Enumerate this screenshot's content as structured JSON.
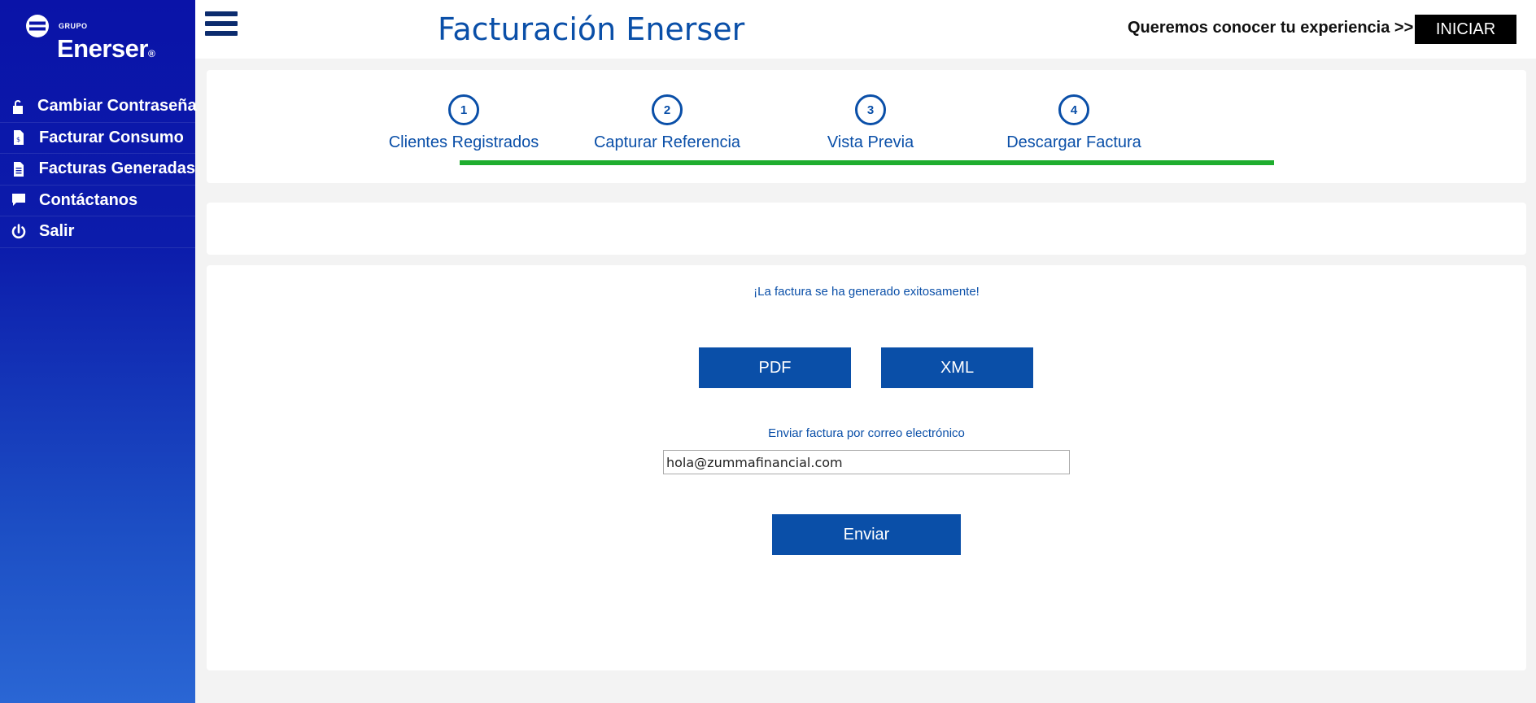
{
  "brand": {
    "group_label": "GRUPO",
    "name": "Enerser",
    "mark": "®"
  },
  "sidebar": {
    "items": [
      {
        "label": "Cambiar Contraseña",
        "icon": "unlock-icon"
      },
      {
        "label": "Facturar Consumo",
        "icon": "invoice-dollar-icon"
      },
      {
        "label": "Facturas Generadas",
        "icon": "document-icon"
      },
      {
        "label": "Contáctanos",
        "icon": "chat-icon"
      },
      {
        "label": "Salir",
        "icon": "power-icon"
      }
    ]
  },
  "header": {
    "title": "Facturación Enerser",
    "survey_text": "Queremos conocer tu experiencia >>",
    "start_label": "INICIAR"
  },
  "steps": [
    {
      "number": "1",
      "label": "Clientes Registrados"
    },
    {
      "number": "2",
      "label": "Capturar Referencia"
    },
    {
      "number": "3",
      "label": "Vista Previa"
    },
    {
      "number": "4",
      "label": "Descargar Factura"
    }
  ],
  "main": {
    "success_message": "¡La factura se ha generado exitosamente!",
    "pdf_label": "PDF",
    "xml_label": "XML",
    "email_label": "Enviar factura por correo electrónico",
    "email_value": "hola@zummafinancial.com",
    "send_label": "Enviar"
  },
  "colors": {
    "primary": "#0a4fa8",
    "progress": "#1fad2e",
    "sidebar_top": "#0a13a8",
    "sidebar_bottom": "#2a66d4"
  }
}
